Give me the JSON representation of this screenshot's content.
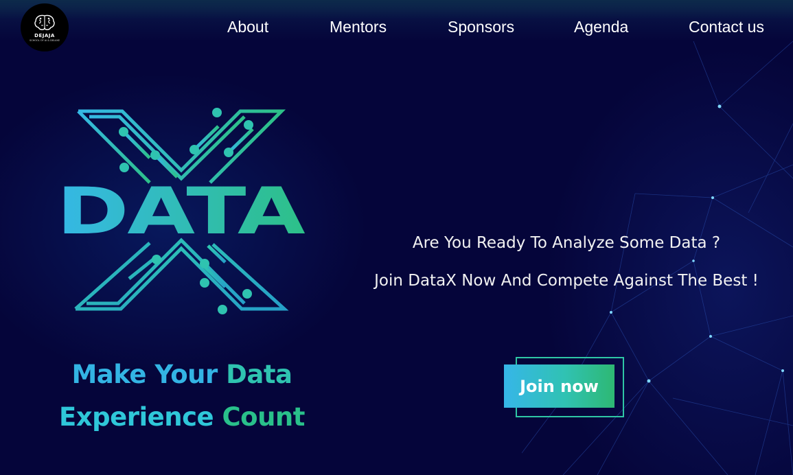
{
  "logo": {
    "name": "DEJAJA",
    "subtitle": "SCHOOL OF AI & DELUXE"
  },
  "nav": {
    "items": [
      {
        "label": "About"
      },
      {
        "label": "Mentors"
      },
      {
        "label": "Sponsors"
      },
      {
        "label": "Agenda"
      },
      {
        "label": "Contact us"
      }
    ]
  },
  "hero": {
    "emblem_text": "DATA",
    "tagline": {
      "line1_part1": "Make Your ",
      "line1_part2": "Data",
      "line2_part1": "Experience ",
      "line2_part2": "Count"
    },
    "headline1": "Are You Ready To Analyze Some Data ?",
    "headline2": "Join DataX Now And Compete Against The Best !",
    "cta_label": "Join now"
  },
  "colors": {
    "background": "#05053a",
    "brand_blue": "#36b6e8",
    "brand_green": "#2eb873",
    "text": "#ffffff"
  }
}
